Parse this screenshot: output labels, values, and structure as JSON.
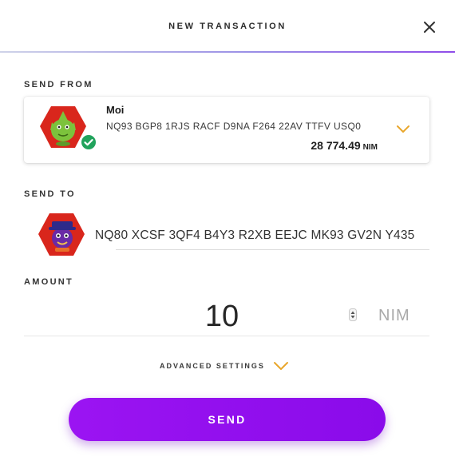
{
  "header": {
    "title": "NEW TRANSACTION",
    "close_icon": "close-icon"
  },
  "send_from": {
    "label": "SEND FROM",
    "account": {
      "name": "Moi",
      "address": "NQ93 BGP8 1RJS RACF D9NA F264 22AV TTFV USQ0",
      "balance": "28 774.49",
      "balance_unit": "NIM",
      "verified_icon": "check-badge-icon",
      "dropdown_icon": "chevron-down-icon"
    }
  },
  "send_to": {
    "label": "SEND TO",
    "address": "NQ80 XCSF 3QF4 B4Y3 R2XB EEJC MK93 GV2N Y435"
  },
  "amount": {
    "label": "AMOUNT",
    "value": "10",
    "unit": "NIM"
  },
  "advanced": {
    "label": "ADVANCED SETTINGS",
    "icon": "chevron-down-icon"
  },
  "send_button": {
    "label": "SEND"
  },
  "colors": {
    "accent": "#8a0bea",
    "chevron": "#e9a62b",
    "verified": "#21a35c"
  }
}
